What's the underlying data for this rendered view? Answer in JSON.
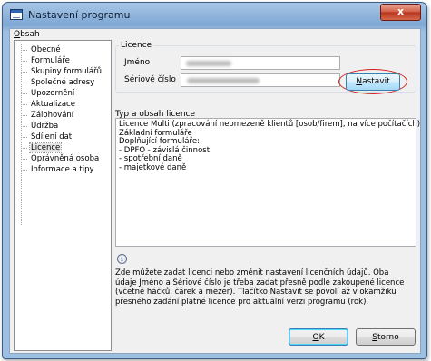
{
  "window": {
    "title": "Nastavení programu",
    "close_glyph": "x",
    "icon": "app-window-icon"
  },
  "tree": {
    "title": "Obsah",
    "items": [
      {
        "label": "Obecné"
      },
      {
        "label": "Formuláře"
      },
      {
        "label": "Skupiny formulářů"
      },
      {
        "label": "Společné adresy"
      },
      {
        "label": "Upozornění"
      },
      {
        "label": "Aktualizace"
      },
      {
        "label": "Zálohování"
      },
      {
        "label": "Údržba"
      },
      {
        "label": "Sdílení dat"
      },
      {
        "label": "Licence",
        "selected": true
      },
      {
        "label": "Oprávněná osoba"
      },
      {
        "label": "Informace a tipy"
      }
    ]
  },
  "licence": {
    "group_title": "Licence",
    "name_label": "Jméno",
    "serial_label": "Sériové číslo",
    "set_button": "Nastavit"
  },
  "type": {
    "label": "Typ a obsah licence",
    "content": "Licence Multi (zpracování neomezeně klientů [osob/firem], na více počítačích)\nZákladní formuláře\nDoplňující formuláře:\n- DPFO - závislá činnost\n- spotřební daně\n- majetkové daně"
  },
  "info": {
    "icon": "info-icon",
    "text": "Zde můžete zadat licenci nebo změnit nastavení licenčních údajů. Oba údaje Jméno a Sériové číslo je třeba zadat přesně podle zakoupené licence (včetně háčků, čárek a mezer). Tlačítko Nastavit se povolí až v okamžiku přesného zadání platné licence pro aktuální verzi  programu (rok)."
  },
  "buttons": {
    "ok": "OK",
    "cancel": "Storno"
  },
  "colors": {
    "highlight_ring": "#d3201b",
    "title_bar": "#9dbfe2"
  }
}
